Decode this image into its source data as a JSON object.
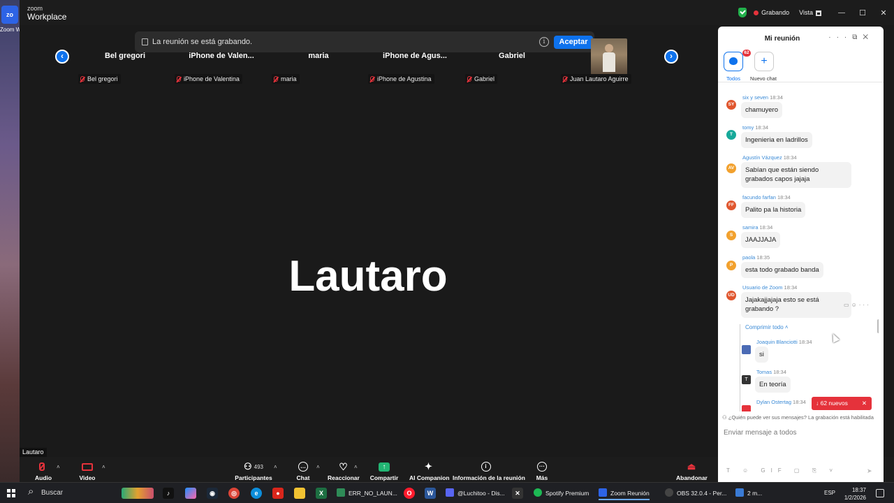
{
  "desktop": {
    "zoom_label": "Zoom W..."
  },
  "titlebar": {
    "brand_line1": "zoom",
    "brand_line2": "Workplace",
    "recording": "Grabando",
    "view": "Vista",
    "close": "✕",
    "maximize": "☐"
  },
  "notice": {
    "text": "La reunión se está grabando.",
    "info": "i",
    "accept": "Aceptar"
  },
  "gallery": {
    "prev": "‹",
    "next": "›",
    "tiles": [
      {
        "name": "Bel gregori",
        "label": "Bel gregori"
      },
      {
        "name": "iPhone de Valen...",
        "label": "iPhone de Valentina"
      },
      {
        "name": "maria",
        "label": "maria"
      },
      {
        "name": "iPhone de Agus...",
        "label": "iPhone de Agustina"
      },
      {
        "name": "Gabriel",
        "label": "Gabriel"
      },
      {
        "name": "",
        "label": "Juan Lautaro Aguirre"
      }
    ]
  },
  "speaker": {
    "name": "Lautaro",
    "tag": "Lautaro"
  },
  "toolbar": {
    "audio": "Audio",
    "video": "Video",
    "participants": "Participantes",
    "participants_count": "493",
    "chat": "Chat",
    "react": "Reaccionar",
    "share": "Compartir",
    "companion": "AI Companion",
    "info": "Información de la reunión",
    "more": "Más",
    "leave": "Abandonar"
  },
  "chat": {
    "title": "Mi reunión",
    "badge": "62",
    "tab_all": "Todos",
    "tab_new": "Nuevo chat",
    "messages": [
      {
        "initials": "SY",
        "color": "#e0562e",
        "author": "six y seven",
        "time": "18:34",
        "text": "chamuyero"
      },
      {
        "initials": "T",
        "color": "#17a99a",
        "author": "tomy",
        "time": "18:34",
        "text": "Ingenieria en ladrillos"
      },
      {
        "initials": "AV",
        "color": "#f2a12e",
        "author": "Agustín Vázquez",
        "time": "18:34",
        "text": "Sabían que están siendo grabados capos jajaja"
      },
      {
        "initials": "FF",
        "color": "#e0562e",
        "author": "facundo farfan",
        "time": "18:34",
        "text": "Palito pa la historia"
      },
      {
        "initials": "S",
        "color": "#f2a12e",
        "author": "samira",
        "time": "18:34",
        "text": "JAAJJAJA"
      },
      {
        "initials": "P",
        "color": "#f2a12e",
        "author": "paola",
        "time": "18:35",
        "text": "esta todo grabado banda"
      },
      {
        "initials": "UD",
        "color": "#e0562e",
        "author": "Usuario de Zoom",
        "time": "18:34",
        "text": "Jajakajjajaja esto se está grabando ?"
      }
    ],
    "compress": "Comprimir todo ˄",
    "replies": [
      {
        "initials": "",
        "color": "#4b6bb5",
        "author": "Joaquin Blanciotti",
        "time": "18:34",
        "text": "si"
      },
      {
        "initials": "T",
        "color": "#333333",
        "author": "Tomas",
        "time": "18:34",
        "text": "En teoría"
      },
      {
        "initials": "",
        "color": "#e5323b",
        "author": "Dylan Ostertag",
        "time": "18:34",
        "text": ""
      }
    ],
    "new_pill": "↓  62 nuevos",
    "new_pill_close": "✕",
    "who_sees": "¿Quién puede ver sus mensajes? La grabación está habilitada",
    "composer_placeholder": "Enviar mensaje a todos",
    "composer_tools": "T ☺ GIF ▢ ⎘ ˅"
  },
  "taskbar": {
    "search": "Buscar",
    "apps": [
      {
        "label": "ERR_NO_LAUN...",
        "color": "#2e8b57"
      },
      {
        "label": "@Luchitoo - Dis...",
        "color": "#5865f2"
      },
      {
        "label": "Spotify Premium",
        "color": "#1db954"
      },
      {
        "label": "Zoom Reunión",
        "color": "#2d63e6"
      },
      {
        "label": "OBS 32.0.4 - Per...",
        "color": "#444444"
      },
      {
        "label": "2 m...",
        "color": "#3a7bd5"
      }
    ],
    "lang": "ESP",
    "time": "18:37",
    "date": "1/2/2026"
  }
}
